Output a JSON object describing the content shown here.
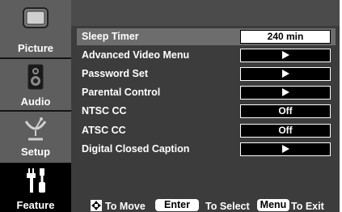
{
  "sidebar": {
    "tabs": [
      {
        "label": "Picture",
        "icon": "tv-screen-icon"
      },
      {
        "label": "Audio",
        "icon": "speaker-icon"
      },
      {
        "label": "Setup",
        "icon": "satellite-dish-icon"
      },
      {
        "label": "Feature",
        "icon": "tools-icon"
      }
    ],
    "active_tab": "Feature"
  },
  "menu": {
    "items": [
      {
        "label": "Sleep Timer",
        "value": "240 min"
      },
      {
        "label": "Advanced Video Menu",
        "value": "",
        "arrow": true
      },
      {
        "label": "Password Set",
        "value": "",
        "arrow": true
      },
      {
        "label": "Parental Control",
        "value": "",
        "arrow": true
      },
      {
        "label": "NTSC CC",
        "value": "Off"
      },
      {
        "label": "ATSC CC",
        "value": "Off"
      },
      {
        "label": "Digital Closed Caption",
        "value": "",
        "arrow": true
      }
    ],
    "selected_item": "Sleep Timer"
  },
  "footer": {
    "move_text": "To Move",
    "enter_key": "Enter",
    "select_text": "To Select",
    "menu_key": "Menu",
    "exit_text": "To Exit",
    "dpad_icon": "dpad-icon"
  },
  "colors": {
    "background": "#3c3c3c",
    "sidebar_tab": "#5e5e5e",
    "sidebar_active": "#000000",
    "selected_row": "#6d6d6d"
  }
}
